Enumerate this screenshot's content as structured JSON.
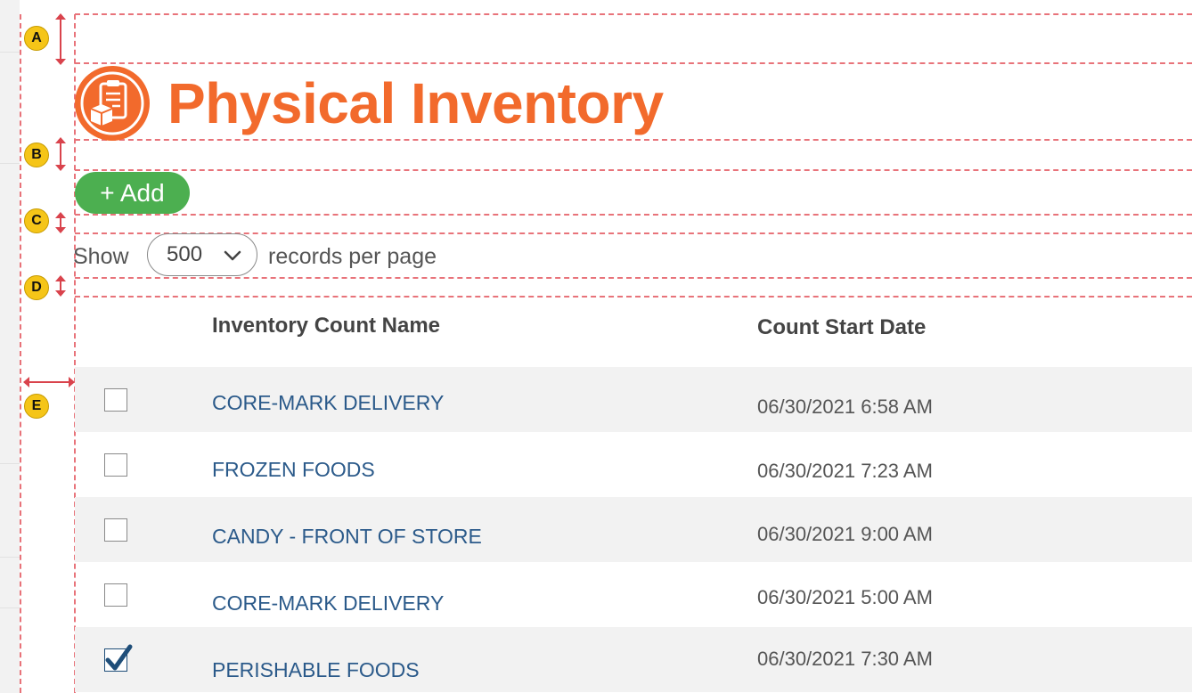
{
  "page": {
    "title": "Physical Inventory",
    "add_label": "+ Add"
  },
  "pagination": {
    "show_label": "Show",
    "page_size": "500",
    "suffix_label": "records per page"
  },
  "table": {
    "headers": {
      "name": "Inventory Count Name",
      "start_date": "Count Start Date"
    },
    "rows": [
      {
        "name": "CORE-MARK DELIVERY",
        "start_date": "06/30/2021 6:58 AM",
        "checked": false
      },
      {
        "name": "FROZEN FOODS",
        "start_date": "06/30/2021 7:23 AM",
        "checked": false
      },
      {
        "name": "CANDY - FRONT OF STORE",
        "start_date": "06/30/2021 9:00 AM",
        "checked": false
      },
      {
        "name": "CORE-MARK DELIVERY",
        "start_date": "06/30/2021 5:00 AM",
        "checked": false
      },
      {
        "name": "PERISHABLE FOODS",
        "start_date": "06/30/2021 7:30 AM",
        "checked": true
      }
    ]
  },
  "annotations": {
    "markers": [
      "A",
      "B",
      "C",
      "D",
      "E"
    ]
  },
  "colors": {
    "brand_orange": "#f26a2c",
    "add_green": "#4caf50",
    "link_blue": "#2b5a8a",
    "guide_red": "#e8737a",
    "marker_yellow": "#f5c518"
  },
  "icons": {
    "logo": "clipboard-boxes-icon",
    "dropdown": "chevron-down-icon",
    "checkbox_checked": "checkmark-icon"
  }
}
